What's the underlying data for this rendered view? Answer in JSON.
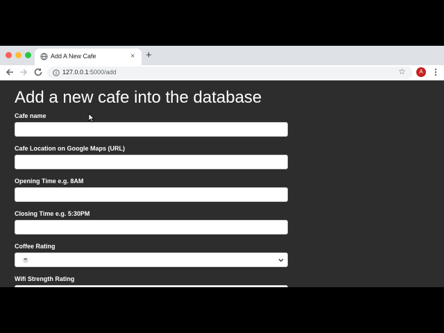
{
  "browser": {
    "tab_title": "Add A New Cafe",
    "new_tab_symbol": "+",
    "close_symbol": "×",
    "url_host": "127.0.0.1",
    "url_path": ":5000/add",
    "avatar_letter": "A"
  },
  "page": {
    "title": "Add a new cafe into the database",
    "fields": [
      {
        "label": "Cafe name",
        "value": ""
      },
      {
        "label": "Cafe Location on Google Maps (URL)",
        "value": ""
      },
      {
        "label": "Opening Time e.g. 8AM",
        "value": ""
      },
      {
        "label": "Closing Time e.g. 5:30PM",
        "value": ""
      },
      {
        "label": "Coffee Rating",
        "selected": "☕"
      },
      {
        "label": "Wifi Strength Rating",
        "value": ""
      }
    ]
  },
  "colors": {
    "page_bg": "#2d2d2d",
    "text": "#ffffff",
    "avatar": "#c5221f"
  }
}
